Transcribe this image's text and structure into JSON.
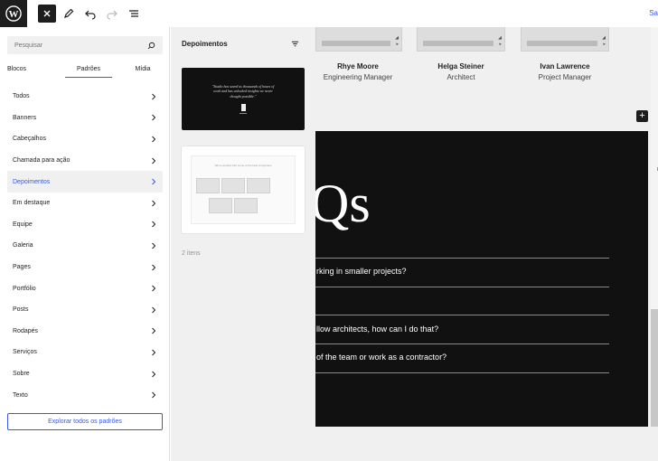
{
  "topbar": {
    "icons": [
      "wordpress-logo",
      "close-icon",
      "pencil-icon",
      "undo-icon",
      "redo-icon",
      "list-view-icon"
    ],
    "right_link": "Sa"
  },
  "inserter": {
    "search_placeholder": "Pesquisar",
    "tabs": [
      {
        "label": "Blocos",
        "active": false
      },
      {
        "label": "Padrões",
        "active": true
      },
      {
        "label": "Mídia",
        "active": false
      }
    ],
    "categories": [
      {
        "label": "Todos",
        "active": false
      },
      {
        "label": "Banners",
        "active": false
      },
      {
        "label": "Cabeçalhos",
        "active": false
      },
      {
        "label": "Chamada para ação",
        "active": false
      },
      {
        "label": "Depoimentos",
        "active": true
      },
      {
        "label": "Em destaque",
        "active": false
      },
      {
        "label": "Equipe",
        "active": false
      },
      {
        "label": "Galeria",
        "active": false
      },
      {
        "label": "Pages",
        "active": false
      },
      {
        "label": "Portfólio",
        "active": false
      },
      {
        "label": "Posts",
        "active": false
      },
      {
        "label": "Rodapés",
        "active": false
      },
      {
        "label": "Serviços",
        "active": false
      },
      {
        "label": "Sobre",
        "active": false
      },
      {
        "label": "Texto",
        "active": false
      }
    ],
    "explore_label": "Explorar todos os padrões"
  },
  "patterns": {
    "title": "Depoimentos",
    "card1_quote": "\"Studio has saved us thousands of hours of work and has unlocked insights we never thought possible.\"",
    "card2_title": "We're worked with some of the best companies",
    "count": "2 itens"
  },
  "canvas": {
    "team": [
      {
        "name": "Rhye Moore",
        "role": "Engineering Manager"
      },
      {
        "name": "Helga Steiner",
        "role": "Architect"
      },
      {
        "name": "Ivan Lawrence",
        "role": "Project Manager"
      }
    ],
    "faq_heading_partial": "Qs",
    "faq_questions": [
      "rking in smaller projects?",
      "llow architects, how can I do that?",
      "of the team or work as a contractor?"
    ]
  },
  "colors": {
    "accent": "#3858e9",
    "dark": "#1e1e1e",
    "panel_bg": "#f0f0f0"
  }
}
